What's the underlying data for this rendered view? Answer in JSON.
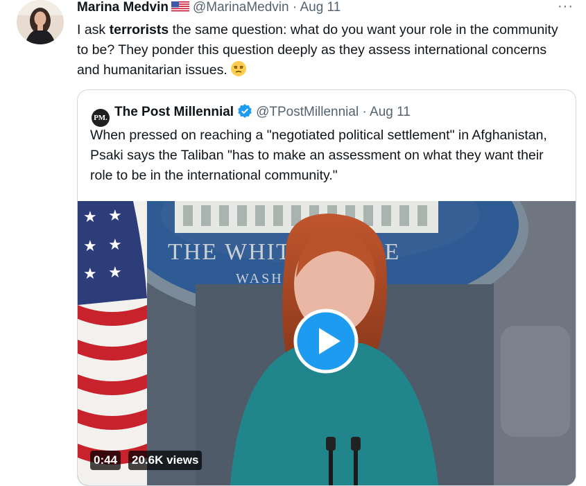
{
  "tweet": {
    "author_name": "Marina Medvin",
    "flag": "us-flag-icon",
    "handle": "@MarinaMedvin",
    "separator": "·",
    "date": "Aug 11",
    "more_label": "···",
    "text_before": "I ask ",
    "text_bold": "terrorists",
    "text_after": " the same question: what do you want your role in the community to be? They ponder this question deeply as they assess international concerns and humanitarian issues.",
    "emoji": "unamused-face-emoji"
  },
  "quoted": {
    "logo_text": "PM.",
    "author_name": "The Post Millennial",
    "verified": "verified-badge-icon",
    "handle": "@TPostMillennial",
    "separator": "·",
    "date": "Aug 11",
    "text": "When pressed on reaching a \"negotiated political settlement\" in Afghanistan, Psaki says the Taliban \"has to make an assessment on what they want their role to be in the international community.\"",
    "video": {
      "duration": "0:44",
      "views": "20.6K views",
      "backdrop_line1": "THE WHITE HOUSE",
      "backdrop_line2": "WASHINGTON"
    }
  },
  "colors": {
    "text": "#0f1419",
    "muted": "#536471",
    "accent": "#1d9bf0",
    "border": "#cfd9de"
  }
}
